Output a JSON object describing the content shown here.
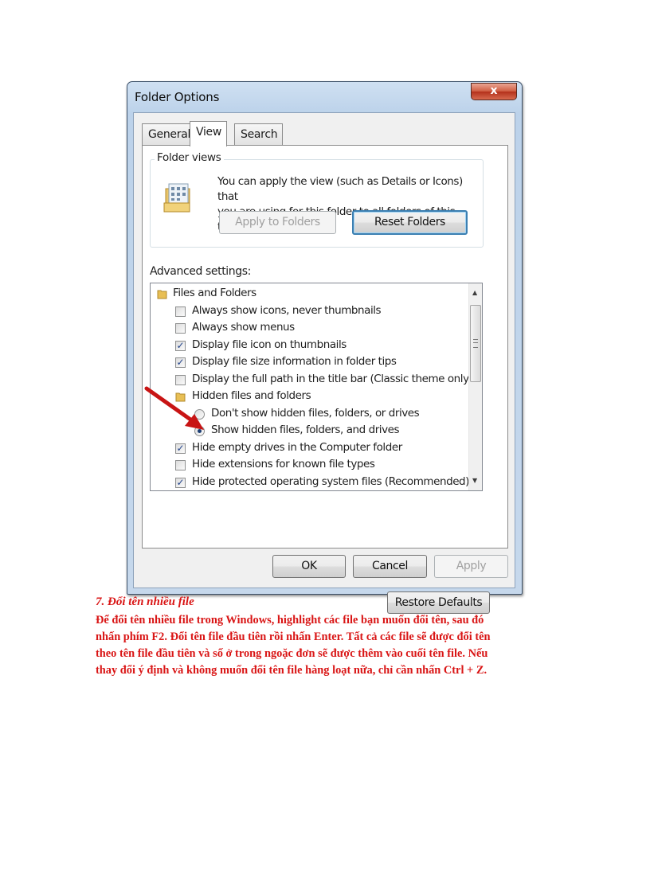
{
  "dialog": {
    "title": "Folder Options",
    "close_label": "x",
    "tabs": [
      {
        "label": "General"
      },
      {
        "label": "View"
      },
      {
        "label": "Search"
      }
    ],
    "folder_views": {
      "title": "Folder views",
      "text_line1": "You can apply the view (such as Details or Icons) that",
      "text_line2": "you are using for this folder to all folders of this type.",
      "apply_button": "Apply to Folders",
      "reset_button": "Reset Folders"
    },
    "advanced_label": "Advanced settings:",
    "tree": [
      {
        "type": "folder",
        "label": "Files and Folders"
      },
      {
        "type": "checkbox",
        "checked": false,
        "label": "Always show icons, never thumbnails"
      },
      {
        "type": "checkbox",
        "checked": false,
        "label": "Always show menus"
      },
      {
        "type": "checkbox",
        "checked": true,
        "label": "Display file icon on thumbnails"
      },
      {
        "type": "checkbox",
        "checked": true,
        "label": "Display file size information in folder tips"
      },
      {
        "type": "checkbox",
        "checked": false,
        "label": "Display the full path in the title bar (Classic theme only)"
      },
      {
        "type": "folder",
        "label": "Hidden files and folders"
      },
      {
        "type": "radio",
        "checked": false,
        "label": "Don't show hidden files, folders, or drives"
      },
      {
        "type": "radio",
        "checked": true,
        "label": "Show hidden files, folders, and drives"
      },
      {
        "type": "checkbox",
        "checked": true,
        "label": "Hide empty drives in the Computer folder"
      },
      {
        "type": "checkbox",
        "checked": false,
        "label": "Hide extensions for known file types"
      },
      {
        "type": "checkbox",
        "checked": true,
        "label": "Hide protected operating system files (Recommended)"
      }
    ],
    "restore_button": "Restore Defaults",
    "ok_button": "OK",
    "cancel_button": "Cancel",
    "apply_button": "Apply"
  },
  "document": {
    "heading": "7. Đổi tên nhiều file",
    "lines": [
      "Để đổi tên nhiều file trong Windows, highlight các file bạn muốn đổi tên, sau đó",
      "nhấn phím F2. Đổi tên file đầu tiên rồi nhấn Enter. Tất cả các file sẽ được đổi tên",
      "theo tên file đầu tiên và số ở trong ngoặc đơn sẽ được thêm vào cuối tên file. Nếu",
      "thay đổi ý định và không muốn đổi tên file hàng loạt nữa, chỉ cần nhấn Ctrl + Z."
    ],
    "text_color": "#d91515",
    "arrow_color": "#c81414"
  }
}
